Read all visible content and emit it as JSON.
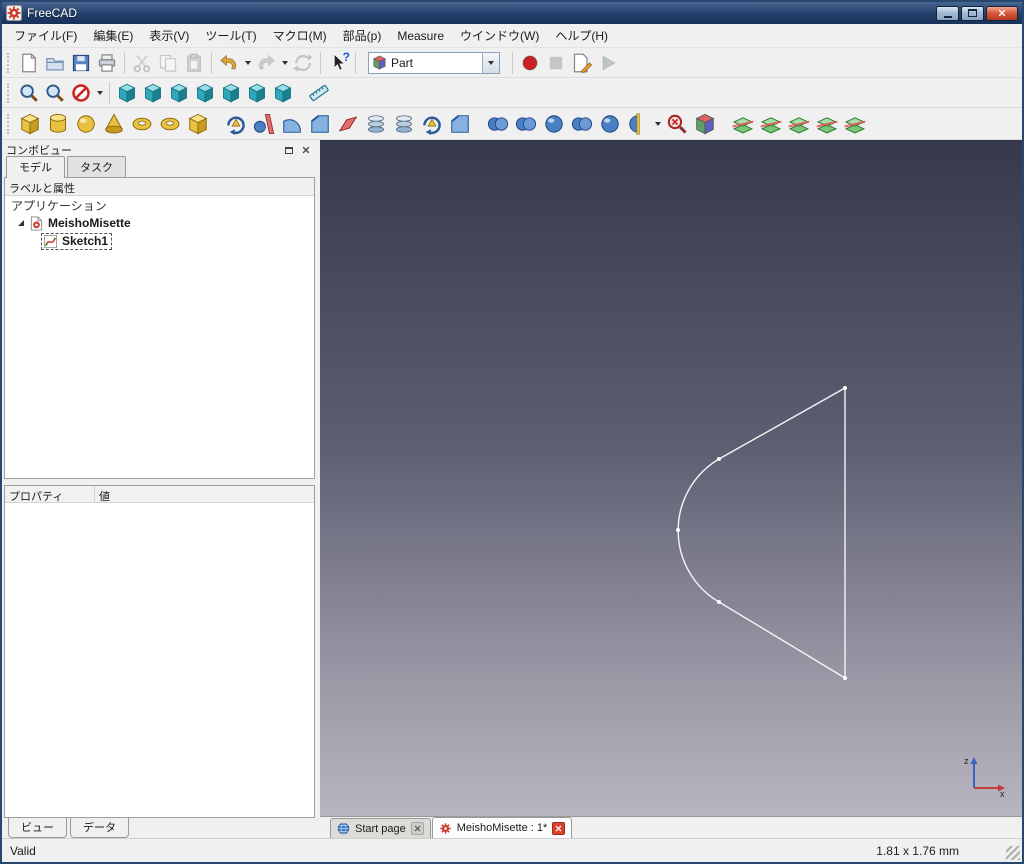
{
  "window": {
    "title": "FreeCAD"
  },
  "window_controls": [
    "minimize",
    "maximize",
    "close"
  ],
  "menu": {
    "items": [
      "ファイル(F)",
      "編集(E)",
      "表示(V)",
      "ツール(T)",
      "マクロ(M)",
      "部品(p)",
      "Measure",
      "ウインドウ(W)",
      "ヘルプ(H)"
    ]
  },
  "toolbar": {
    "workbench_selected": "Part",
    "standard_icons": [
      "new-document",
      "open-file",
      "save",
      "print",
      "cut",
      "copy",
      "paste",
      "undo",
      "redo",
      "refresh",
      "whats-this",
      "workbench-selector",
      "macro-record",
      "macro-stop",
      "macro-edit",
      "macro-play"
    ],
    "view_icons": [
      "fit-all",
      "zoom",
      "draw-style",
      "axonometric-view",
      "front-view",
      "top-view",
      "right-view",
      "rear-view",
      "bottom-view",
      "left-view",
      "measure"
    ],
    "part_icons": [
      "box",
      "cylinder",
      "sphere",
      "cone",
      "torus",
      "tube",
      "shape-builder",
      "revolve",
      "mirror",
      "fillet",
      "chamfer",
      "make-face",
      "ruled-surface",
      "loft",
      "sweep",
      "offset",
      "compound",
      "boolean",
      "cut",
      "union",
      "common",
      "section",
      "check-geometry",
      "defeaturing",
      "cross-sections",
      "slice",
      "slice-apart",
      "boolean-fragments",
      "explode"
    ]
  },
  "icons": {
    "whats_this_glyph": "?"
  },
  "combo_view": {
    "title": "コンボビュー",
    "tabs": {
      "model": "モデル",
      "task": "タスク"
    },
    "tree_header": "ラベルと属性",
    "tree": {
      "application": "アプリケーション",
      "document": "MeishoMisette",
      "sketch": "Sketch1"
    },
    "properties": {
      "col_property": "プロパティ",
      "col_value": "値"
    },
    "bottom_tabs": {
      "view": "ビュー",
      "data": "データ"
    }
  },
  "mdi_tabs": [
    {
      "label": "Start page"
    },
    {
      "label": "MeishoMisette : 1*"
    }
  ],
  "viewport": {
    "axis_z": "z",
    "axis_x": "x"
  },
  "status": {
    "message": "Valid",
    "dimensions": "1.81 x 1.76 mm"
  },
  "colors": {
    "viewport_top": "#36384c",
    "viewport_bottom": "#b7b5be",
    "sketch_line": "#f5f5f5",
    "titlebar": "#23406b",
    "close_red": "#d8432f",
    "teal_icon": "#2fa8bc",
    "yellow_icon": "#e8c23e"
  }
}
